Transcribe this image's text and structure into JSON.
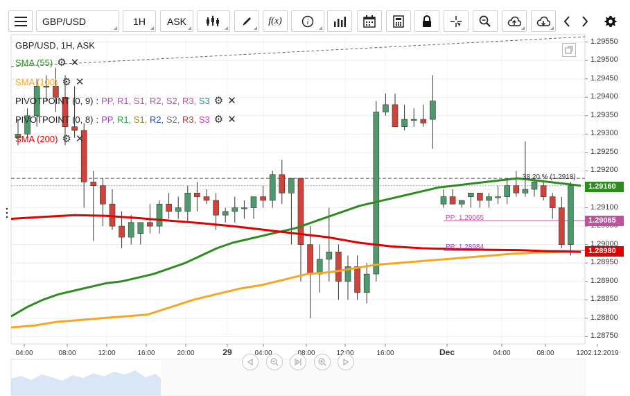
{
  "toolbar": {
    "symbol": "GBP/USD",
    "timeframe": "1H",
    "price_type": "ASK",
    "function_label": "f(x)",
    "info_label": "i"
  },
  "legend": {
    "header": "GBP/USD, 1H, ASK",
    "sma55": "SMA (55)",
    "sma100": "SMA (100)",
    "sma200": "SMA (200)",
    "pivot1_name": "PIVOTPOINT (0, 9)",
    "pivot2_name": "PIVOTPOINT (0, 8)",
    "pivot_sep": ":",
    "pivot_levels": [
      "PP,",
      "R1,",
      "S1,",
      "R2,",
      "S2,",
      "R3,",
      "S3"
    ]
  },
  "colors": {
    "up": "#4f9a6d",
    "down": "#d0433a",
    "sma55": "#2e8b1f",
    "sma100": "#f5a623",
    "sma200": "#e00000",
    "pp1": "#c050a0",
    "pp2": "#9a40c8"
  },
  "annotations": {
    "fib": "38.20 % (1.2918)",
    "pp1": "PP: 1.29065",
    "pp2": "PP: 1.28984"
  },
  "price_boxes": {
    "sma55": "1.29160",
    "pp": "1.29065",
    "sma200": "1.28980"
  },
  "chart_data": {
    "type": "candlestick",
    "title": "GBP/USD, 1H, ASK",
    "ylim": [
      1.2873,
      1.2957
    ],
    "y_ticks": [
      "1.29550",
      "1.29500",
      "1.29450",
      "1.29400",
      "1.29350",
      "1.29300",
      "1.29250",
      "1.29200",
      "1.29150",
      "1.29100",
      "1.29050",
      "1.29000",
      "1.28950",
      "1.28900",
      "1.28850",
      "1.28800",
      "1.28750"
    ],
    "x_ticks": [
      "04:00",
      "08:00",
      "12:00",
      "16:00",
      "20:00",
      "29",
      "04:00",
      "08:00",
      "12:00",
      "16:00",
      "Dec",
      "04:00",
      "08:00",
      "1202.12.2019"
    ],
    "candles": [
      {
        "o": 1.2929,
        "h": 1.2934,
        "l": 1.2927,
        "c": 1.293
      },
      {
        "o": 1.293,
        "h": 1.2937,
        "l": 1.2929,
        "c": 1.2935
      },
      {
        "o": 1.2935,
        "h": 1.2945,
        "l": 1.2932,
        "c": 1.2943
      },
      {
        "o": 1.2943,
        "h": 1.2946,
        "l": 1.2939,
        "c": 1.2943
      },
      {
        "o": 1.2943,
        "h": 1.2948,
        "l": 1.2936,
        "c": 1.294
      },
      {
        "o": 1.294,
        "h": 1.2946,
        "l": 1.2927,
        "c": 1.2932
      },
      {
        "o": 1.2932,
        "h": 1.2943,
        "l": 1.2929,
        "c": 1.2931
      },
      {
        "o": 1.2931,
        "h": 1.2933,
        "l": 1.291,
        "c": 1.2917
      },
      {
        "o": 1.2917,
        "h": 1.292,
        "l": 1.2901,
        "c": 1.2916
      },
      {
        "o": 1.2916,
        "h": 1.2918,
        "l": 1.2905,
        "c": 1.2911
      },
      {
        "o": 1.2911,
        "h": 1.2915,
        "l": 1.2904,
        "c": 1.2905
      },
      {
        "o": 1.2905,
        "h": 1.2909,
        "l": 1.2899,
        "c": 1.2902
      },
      {
        "o": 1.2902,
        "h": 1.2908,
        "l": 1.29,
        "c": 1.2906
      },
      {
        "o": 1.2903,
        "h": 1.2905,
        "l": 1.29,
        "c": 1.2906
      },
      {
        "o": 1.2906,
        "h": 1.2911,
        "l": 1.2903,
        "c": 1.2905
      },
      {
        "o": 1.2905,
        "h": 1.2912,
        "l": 1.2903,
        "c": 1.2911
      },
      {
        "o": 1.2911,
        "h": 1.2914,
        "l": 1.2907,
        "c": 1.2909
      },
      {
        "o": 1.2909,
        "h": 1.2913,
        "l": 1.2907,
        "c": 1.291
      },
      {
        "o": 1.2909,
        "h": 1.2916,
        "l": 1.2906,
        "c": 1.2914
      },
      {
        "o": 1.2914,
        "h": 1.2917,
        "l": 1.2909,
        "c": 1.2913
      },
      {
        "o": 1.2913,
        "h": 1.2915,
        "l": 1.2911,
        "c": 1.2912
      },
      {
        "o": 1.2912,
        "h": 1.2914,
        "l": 1.2904,
        "c": 1.2908
      },
      {
        "o": 1.2908,
        "h": 1.291,
        "l": 1.2906,
        "c": 1.2909
      },
      {
        "o": 1.2909,
        "h": 1.2913,
        "l": 1.2906,
        "c": 1.291
      },
      {
        "o": 1.291,
        "h": 1.2912,
        "l": 1.2907,
        "c": 1.291
      },
      {
        "o": 1.291,
        "h": 1.2913,
        "l": 1.2907,
        "c": 1.2913
      },
      {
        "o": 1.2913,
        "h": 1.2916,
        "l": 1.291,
        "c": 1.2912
      },
      {
        "o": 1.2912,
        "h": 1.292,
        "l": 1.291,
        "c": 1.2919
      },
      {
        "o": 1.2919,
        "h": 1.2923,
        "l": 1.2911,
        "c": 1.2914
      },
      {
        "o": 1.2914,
        "h": 1.2918,
        "l": 1.29,
        "c": 1.2918
      },
      {
        "o": 1.2918,
        "h": 1.2918,
        "l": 1.289,
        "c": 1.29
      },
      {
        "o": 1.29,
        "h": 1.2905,
        "l": 1.288,
        "c": 1.2892
      },
      {
        "o": 1.2892,
        "h": 1.29,
        "l": 1.2887,
        "c": 1.2896
      },
      {
        "o": 1.2896,
        "h": 1.291,
        "l": 1.289,
        "c": 1.2898
      },
      {
        "o": 1.2898,
        "h": 1.29,
        "l": 1.2885,
        "c": 1.289
      },
      {
        "o": 1.289,
        "h": 1.2897,
        "l": 1.2885,
        "c": 1.2894
      },
      {
        "o": 1.2894,
        "h": 1.2897,
        "l": 1.2885,
        "c": 1.2887
      },
      {
        "o": 1.2887,
        "h": 1.2895,
        "l": 1.2884,
        "c": 1.2892
      },
      {
        "o": 1.2892,
        "h": 1.2939,
        "l": 1.289,
        "c": 1.2936
      },
      {
        "o": 1.2936,
        "h": 1.2941,
        "l": 1.2935,
        "c": 1.2938
      },
      {
        "o": 1.2938,
        "h": 1.2941,
        "l": 1.2932,
        "c": 1.2932
      },
      {
        "o": 1.2932,
        "h": 1.2938,
        "l": 1.2931,
        "c": 1.2934
      },
      {
        "o": 1.2934,
        "h": 1.2937,
        "l": 1.2932,
        "c": 1.2934
      },
      {
        "o": 1.2934,
        "h": 1.2938,
        "l": 1.2932,
        "c": 1.2933
      },
      {
        "o": 1.2934,
        "h": 1.2946,
        "l": 1.2926,
        "c": 1.2939
      },
      {
        "o": 1.2911,
        "h": 1.2915,
        "l": 1.291,
        "c": 1.2913
      },
      {
        "o": 1.2913,
        "h": 1.2915,
        "l": 1.2911,
        "c": 1.2911
      },
      {
        "o": 1.2911,
        "h": 1.2912,
        "l": 1.291,
        "c": 1.2912
      },
      {
        "o": 1.2913,
        "h": 1.2914,
        "l": 1.291,
        "c": 1.2914
      },
      {
        "o": 1.2914,
        "h": 1.2914,
        "l": 1.291,
        "c": 1.2912
      },
      {
        "o": 1.2912,
        "h": 1.2914,
        "l": 1.291,
        "c": 1.2913
      },
      {
        "o": 1.2913,
        "h": 1.2916,
        "l": 1.2911,
        "c": 1.2913
      },
      {
        "o": 1.2913,
        "h": 1.2918,
        "l": 1.2911,
        "c": 1.2916
      },
      {
        "o": 1.2916,
        "h": 1.292,
        "l": 1.2913,
        "c": 1.2914
      },
      {
        "o": 1.2914,
        "h": 1.2928,
        "l": 1.2913,
        "c": 1.2915
      },
      {
        "o": 1.2915,
        "h": 1.2918,
        "l": 1.2913,
        "c": 1.2917
      },
      {
        "o": 1.2916,
        "h": 1.2917,
        "l": 1.2912,
        "c": 1.2913
      },
      {
        "o": 1.2913,
        "h": 1.2914,
        "l": 1.2907,
        "c": 1.291
      },
      {
        "o": 1.291,
        "h": 1.2913,
        "l": 1.2899,
        "c": 1.29
      },
      {
        "o": 1.29,
        "h": 1.2917,
        "l": 1.2897,
        "c": 1.2916
      }
    ],
    "series": [
      {
        "name": "SMA (55)",
        "values": [
          1.28805,
          1.2883,
          1.2885,
          1.28865,
          1.28875,
          1.28885,
          1.28895,
          1.289,
          1.2891,
          1.2892,
          1.28935,
          1.2895,
          1.2897,
          1.2899,
          1.29005,
          1.29015,
          1.29025,
          1.29035,
          1.29045,
          1.2906,
          1.29075,
          1.2909,
          1.29105,
          1.29115,
          1.29125,
          1.29135,
          1.29145,
          1.29155,
          1.2916,
          1.29165,
          1.2917,
          1.29175,
          1.2918,
          1.29175,
          1.2917,
          1.29165,
          1.2916
        ]
      },
      {
        "name": "SMA (100)",
        "values": [
          1.28775,
          1.2878,
          1.2879,
          1.28795,
          1.288,
          1.28805,
          1.2881,
          1.2883,
          1.2885,
          1.28865,
          1.2888,
          1.2889,
          1.28905,
          1.2892,
          1.28925,
          1.28935,
          1.28945,
          1.2895,
          1.28955,
          1.2896,
          1.28965,
          1.2897,
          1.28975,
          1.28978,
          1.2898,
          1.28982
        ]
      },
      {
        "name": "SMA (200)",
        "values": [
          1.2907,
          1.29075,
          1.2908,
          1.29078,
          1.29072,
          1.29065,
          1.29058,
          1.2905,
          1.2904,
          1.2903,
          1.2902,
          1.29005,
          1.28995,
          1.2899,
          1.28988,
          1.28986,
          1.28985,
          1.28982,
          1.2898
        ]
      }
    ],
    "reference_lines": [
      {
        "label": "38.20 % (1.2918)",
        "value": 1.2918
      },
      {
        "label": "PP: 1.29065",
        "value": 1.29065
      },
      {
        "label": "PP: 1.28984",
        "value": 1.28984
      }
    ]
  }
}
